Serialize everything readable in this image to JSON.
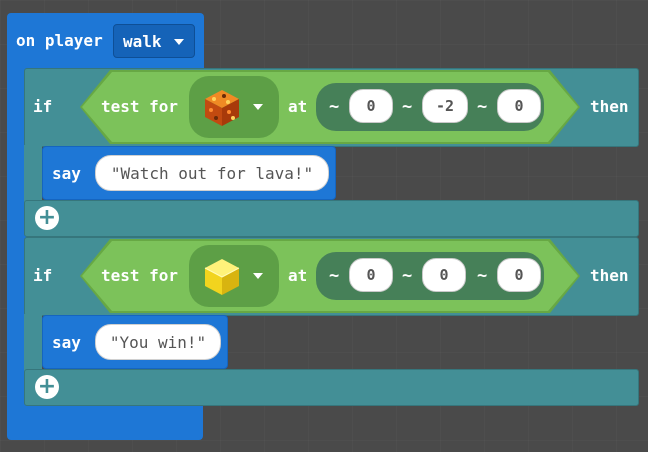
{
  "event": {
    "prefix": "on player",
    "selected": "walk"
  },
  "if_blocks": [
    {
      "if_label": "if",
      "condition": {
        "label": "test for",
        "item_icon": "magma-block-icon",
        "at_label": "at",
        "coords": [
          {
            "tilde": "~",
            "value": "0"
          },
          {
            "tilde": "~",
            "value": "-2"
          },
          {
            "tilde": "~",
            "value": "0"
          }
        ]
      },
      "then_label": "then",
      "say": {
        "label": "say",
        "text": "Watch out for lava!"
      }
    },
    {
      "if_label": "if",
      "condition": {
        "label": "test for",
        "item_icon": "gold-block-icon",
        "at_label": "at",
        "coords": [
          {
            "tilde": "~",
            "value": "0"
          },
          {
            "tilde": "~",
            "value": "0"
          },
          {
            "tilde": "~",
            "value": "0"
          }
        ]
      },
      "then_label": "then",
      "say": {
        "label": "say",
        "text": "You win!"
      }
    }
  ],
  "colors": {
    "event": "#1e77d6",
    "logic": "#438f96",
    "condition": "#7cc25a",
    "background": "#4a4a4a"
  }
}
